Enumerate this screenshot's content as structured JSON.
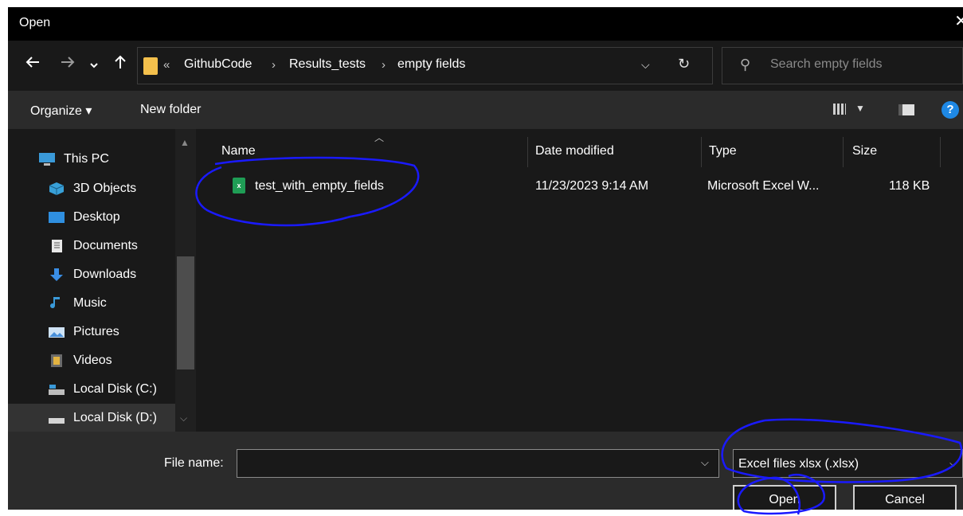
{
  "window": {
    "title": "Open",
    "close_glyph": "✕"
  },
  "nav": {
    "back_icon": "arrow-left-icon",
    "forward_icon": "arrow-right-icon",
    "recent_icon": "chevron-down-icon",
    "up_icon": "arrow-up-icon",
    "overflow": "«",
    "breadcrumbs": [
      "GithubCode",
      "Results_tests",
      "empty fields"
    ],
    "search_placeholder": "Search empty fields"
  },
  "toolbar": {
    "organize_label": "Organize ▾",
    "new_folder_label": "New folder",
    "help_label": "?"
  },
  "nav_pane": {
    "items": [
      {
        "label": "This PC",
        "icon": "computer-icon"
      },
      {
        "label": "3D Objects",
        "icon": "cube-icon"
      },
      {
        "label": "Desktop",
        "icon": "desktop-icon"
      },
      {
        "label": "Documents",
        "icon": "document-icon"
      },
      {
        "label": "Downloads",
        "icon": "download-icon"
      },
      {
        "label": "Music",
        "icon": "music-icon"
      },
      {
        "label": "Pictures",
        "icon": "pictures-icon"
      },
      {
        "label": "Videos",
        "icon": "video-icon"
      },
      {
        "label": "Local Disk (C:)",
        "icon": "drive-icon"
      },
      {
        "label": "Local Disk (D:)",
        "icon": "drive-icon"
      }
    ]
  },
  "file_list": {
    "columns": [
      "Name",
      "Date modified",
      "Type",
      "Size"
    ],
    "rows": [
      {
        "name": "test_with_empty_fields",
        "date_modified": "11/23/2023 9:14 AM",
        "type": "Microsoft Excel W...",
        "size": "118 KB",
        "icon": "excel-file-icon"
      }
    ]
  },
  "bottom": {
    "file_name_label": "File name:",
    "file_name_value": "",
    "file_type_filter": "Excel files xlsx (.xlsx)",
    "open_label": "Open",
    "cancel_label": "Cancel"
  },
  "colors": {
    "background": "#191919",
    "toolbar": "#2b2b2b",
    "annotation": "#1a1aff",
    "folder": "#f4c04c",
    "excel": "#1f9d55",
    "help": "#1e88e5"
  }
}
